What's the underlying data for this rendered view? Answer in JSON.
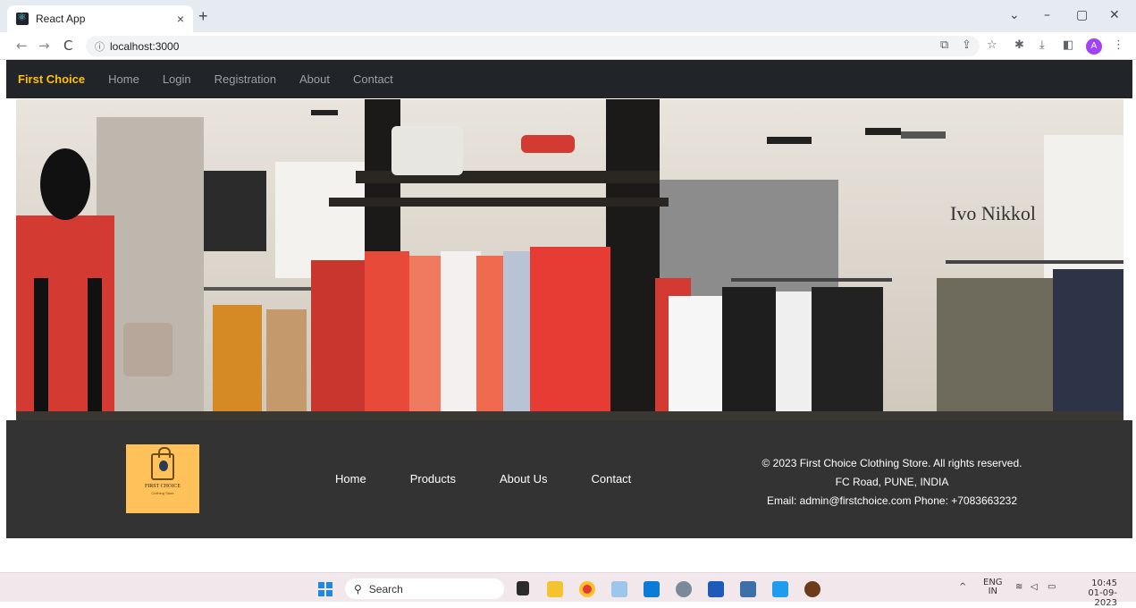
{
  "browser": {
    "tab_title": "React App",
    "tab_close": "×",
    "new_tab": "+",
    "url": "localhost:3000",
    "back": "←",
    "forward": "→",
    "reload": "C",
    "site_info": "ⓘ",
    "minimize": "–",
    "restore": "▢",
    "close": "✕",
    "chevron": "⌄",
    "profile_initial": "A",
    "toolbar_icons": [
      "install-icon",
      "share-icon",
      "star-icon",
      "extensions-icon",
      "download-icon",
      "sidepanel-icon",
      "menu-icon"
    ]
  },
  "navbar": {
    "brand": "First Choice",
    "links": [
      "Home",
      "Login",
      "Registration",
      "About",
      "Contact"
    ]
  },
  "hero": {
    "store_sign": "Ivo Nikkol"
  },
  "footer": {
    "logo_name": "FIRST CHOICE",
    "logo_tagline": "Clothing Store",
    "links": [
      "Home",
      "Products",
      "About Us",
      "Contact"
    ],
    "copyright": "© 2023 First Choice Clothing Store. All rights reserved.",
    "address": "FC Road, PUNE, INDIA",
    "contact": "Email: admin@firstchoice.com Phone: +7083663232"
  },
  "taskbar": {
    "search_placeholder": "Search",
    "apps": [
      "file-explorer-icon",
      "folder-icon",
      "chrome-icon",
      "photos-icon",
      "desktop-icon",
      "settings-icon",
      "word-icon",
      "app-icon",
      "vscode-icon",
      "other-icon"
    ],
    "language_top": "ENG",
    "language_bottom": "IN",
    "time": "10:45",
    "date": "01-09-2023",
    "tray_chevron": "^"
  },
  "colors": {
    "navbar_bg": "#212529",
    "brand": "#ffc107",
    "footer_bg": "#333333",
    "logo_bg": "#ffc15a"
  }
}
